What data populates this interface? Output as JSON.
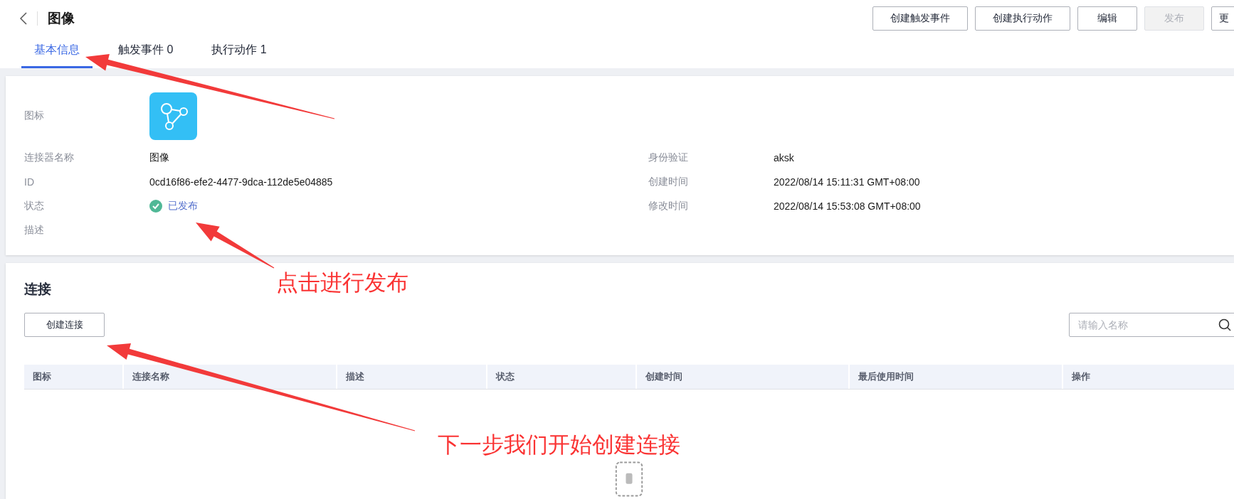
{
  "header": {
    "title": "图像",
    "actions": [
      {
        "label": "创建触发事件",
        "disabled": false
      },
      {
        "label": "创建执行动作",
        "disabled": false
      },
      {
        "label": "编辑",
        "disabled": false
      },
      {
        "label": "发布",
        "disabled": true
      },
      {
        "label": "更",
        "disabled": false
      }
    ]
  },
  "tabs": [
    {
      "label": "基本信息",
      "selected": true
    },
    {
      "label": "触发事件 0",
      "selected": false
    },
    {
      "label": "执行动作 1",
      "selected": false
    }
  ],
  "basic_info": {
    "icon_label": "图标",
    "left": [
      {
        "label": "连接器名称",
        "value": "图像",
        "kind": "text"
      },
      {
        "label": "ID",
        "value": "0cd16f86-efe2-4477-9dca-112de5e04885",
        "kind": "text"
      },
      {
        "label": "状态",
        "value": "已发布",
        "kind": "status"
      },
      {
        "label": "描述",
        "kind": "text"
      }
    ],
    "right": [
      {
        "label": "身份验证",
        "value": "aksk"
      },
      {
        "label": "创建时间",
        "value": "2022/08/14 15:11:31 GMT+08:00"
      },
      {
        "label": "修改时间",
        "value": "2022/08/14 15:53:08 GMT+08:00"
      }
    ]
  },
  "connections": {
    "title": "连接",
    "create_button": "创建连接",
    "search": {
      "placeholder": "请输入名称"
    },
    "table": {
      "columns": [
        "图标",
        "连接名称",
        "描述",
        "状态",
        "创建时间",
        "最后使用时间",
        "操作"
      ]
    }
  },
  "annotations": [
    {
      "text": "点击进行发布"
    },
    {
      "text": "下一步我们开始创建连接"
    }
  ]
}
